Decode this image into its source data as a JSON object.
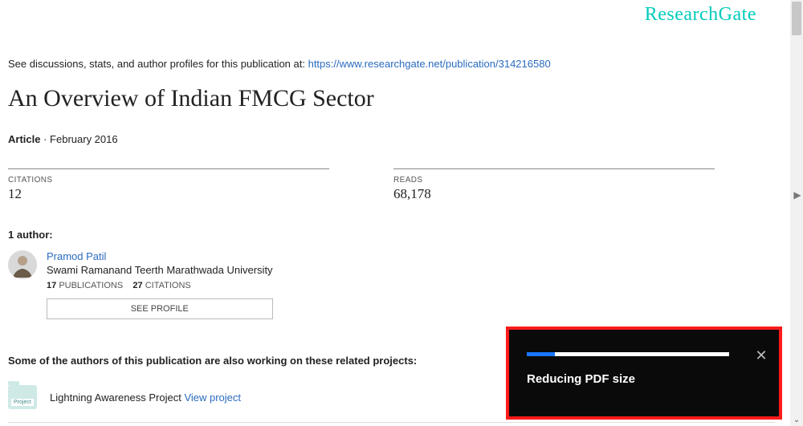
{
  "brand": "ResearchGate",
  "intro_prefix": "See discussions, stats, and author profiles for this publication at: ",
  "intro_link": "https://www.researchgate.net/publication/314216580",
  "title": "An Overview of Indian FMCG Sector",
  "doc_type": "Article",
  "doc_date": "February 2016",
  "stats": {
    "citations_label": "CITATIONS",
    "citations_value": "12",
    "reads_label": "READS",
    "reads_value": "68,178"
  },
  "authors_header": "1 author:",
  "author": {
    "name": "Pramod Patil",
    "affiliation": "Swami Ramanand Teerth Marathwada University",
    "publications_n": "17",
    "publications_label": "PUBLICATIONS",
    "citations_n": "27",
    "citations_label": "CITATIONS",
    "see_profile": "SEE PROFILE"
  },
  "related_header": "Some of the authors of this publication are also working on these related projects:",
  "project": {
    "icon_label": "Project",
    "name": "Lightning Awareness Project",
    "view_label": "View project"
  },
  "toast": {
    "message": "Reducing PDF size",
    "progress_pct": 14
  }
}
